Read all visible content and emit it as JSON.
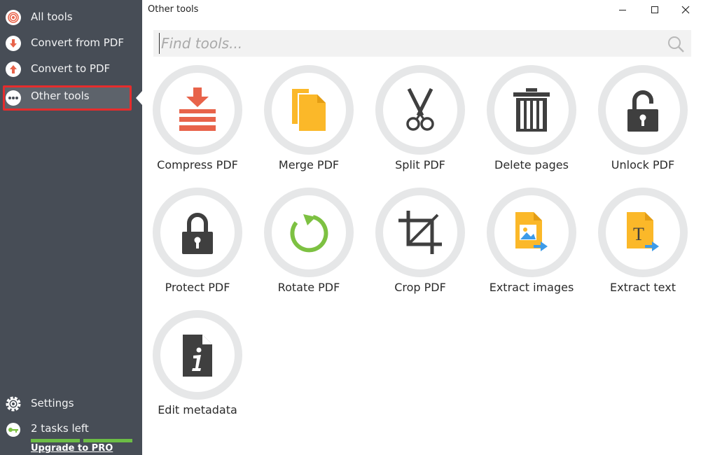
{
  "sidebar": {
    "items": [
      {
        "label": "All tools",
        "icon": "spiral-icon"
      },
      {
        "label": "Convert from PDF",
        "icon": "arrow-down-icon"
      },
      {
        "label": "Convert to PDF",
        "icon": "arrow-up-icon"
      },
      {
        "label": "Other tools",
        "icon": "more-dots-icon",
        "active": true
      }
    ],
    "settings_label": "Settings",
    "tasks_label": "2 tasks left",
    "upgrade_label": "Upgrade to PRO"
  },
  "window": {
    "title": "Other tools"
  },
  "search": {
    "placeholder": "Find tools..."
  },
  "tools": [
    {
      "label": "Compress PDF",
      "icon": "compress-icon"
    },
    {
      "label": "Merge PDF",
      "icon": "merge-icon"
    },
    {
      "label": "Split PDF",
      "icon": "scissors-icon"
    },
    {
      "label": "Delete pages",
      "icon": "trash-icon"
    },
    {
      "label": "Unlock PDF",
      "icon": "unlock-icon"
    },
    {
      "label": "Protect PDF",
      "icon": "lock-icon"
    },
    {
      "label": "Rotate PDF",
      "icon": "rotate-icon"
    },
    {
      "label": "Crop PDF",
      "icon": "crop-icon"
    },
    {
      "label": "Extract images",
      "icon": "extract-images-icon"
    },
    {
      "label": "Extract text",
      "icon": "extract-text-icon"
    },
    {
      "label": "Edit metadata",
      "icon": "metadata-icon"
    }
  ],
  "colors": {
    "sidebar_bg": "#474d56",
    "accent_red": "#e8634a",
    "accent_orange": "#fbb829",
    "accent_green": "#7dc142",
    "accent_blue": "#3d9be9",
    "highlight_border": "#e62c2c",
    "progress_green": "#6cbd45"
  }
}
